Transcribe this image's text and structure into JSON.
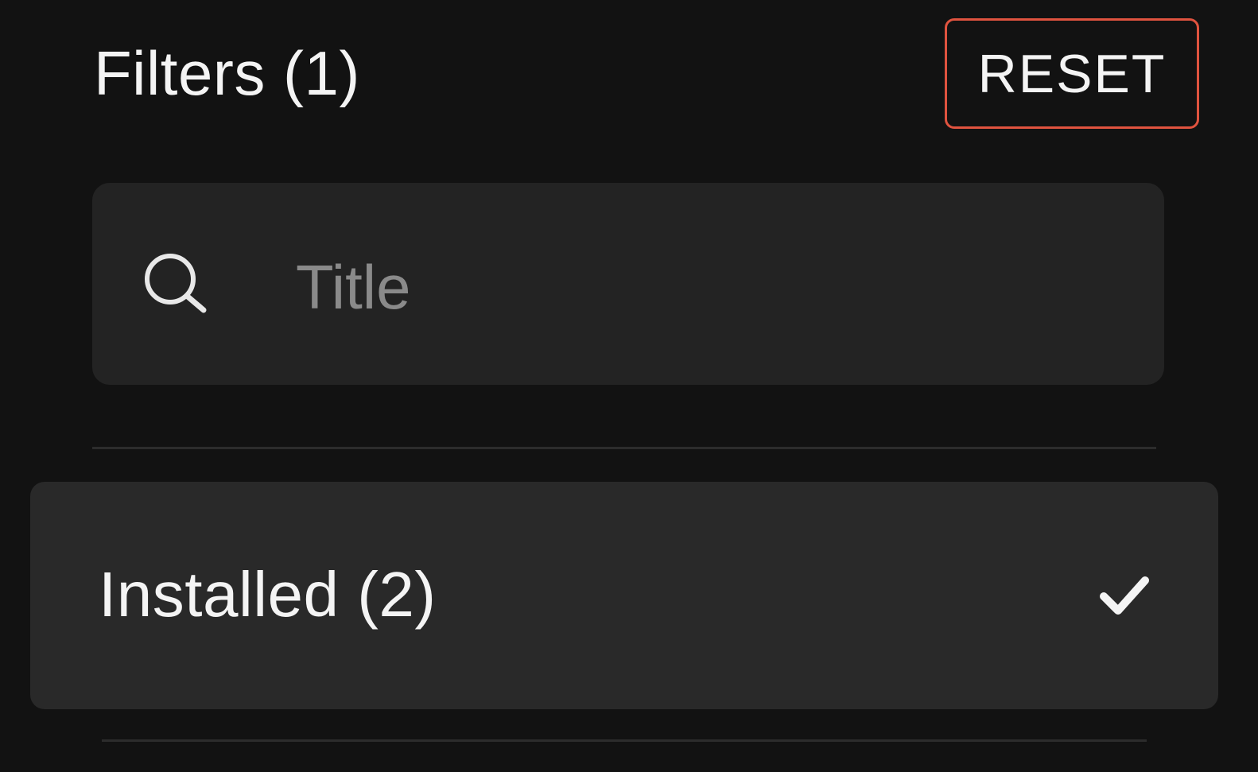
{
  "header": {
    "title": "Filters (1)",
    "reset_label": "RESET"
  },
  "search": {
    "placeholder": "Title",
    "value": "",
    "icon": "search-icon"
  },
  "filters": {
    "options": [
      {
        "label": "Installed (2)",
        "selected": true,
        "icon": "check-icon"
      }
    ]
  },
  "colors": {
    "background": "#121212",
    "accent_border": "#e0533f",
    "search_background": "#232323",
    "option_background": "#292929",
    "text": "#f4f4f4",
    "placeholder": "#8a8a8a"
  }
}
